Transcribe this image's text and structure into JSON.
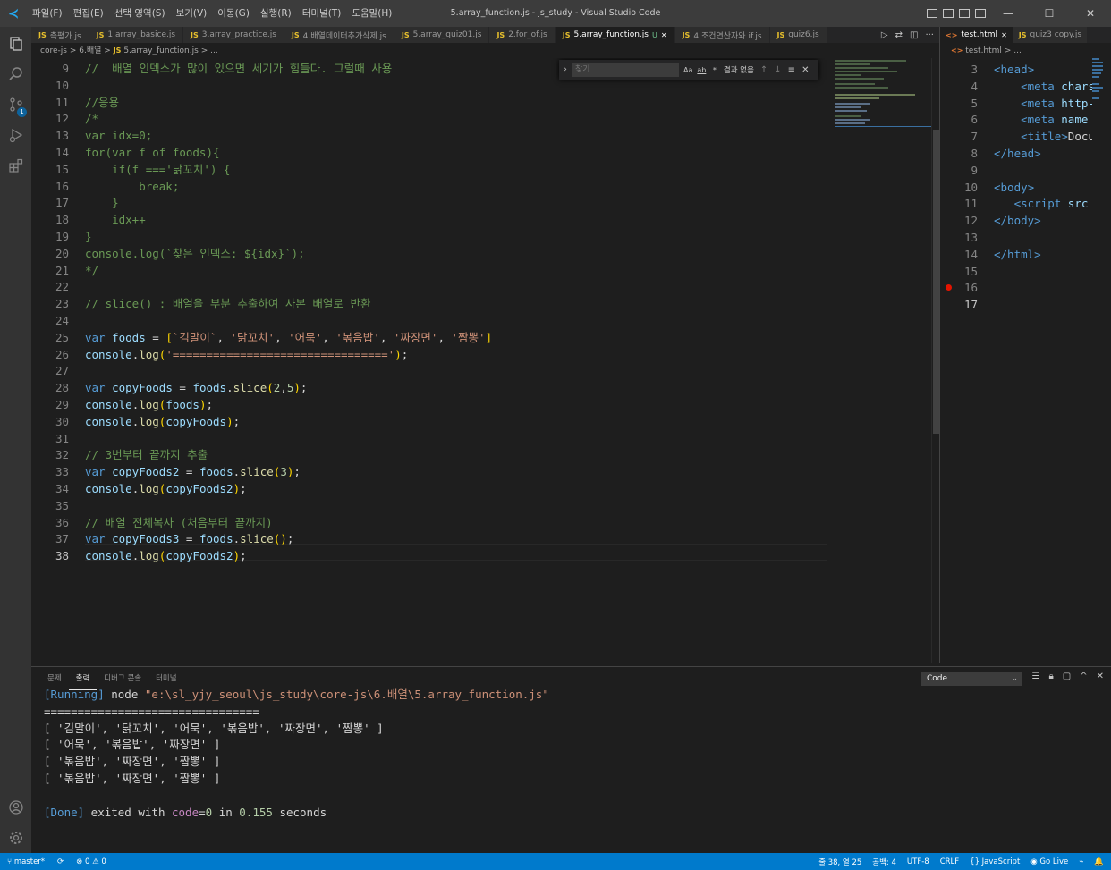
{
  "window": {
    "title": "5.array_function.js - js_study - Visual Studio Code",
    "menu": [
      "파일(F)",
      "편집(E)",
      "선택 영역(S)",
      "보기(V)",
      "이동(G)",
      "실행(R)",
      "터미널(T)",
      "도움말(H)"
    ],
    "controls": [
      "—",
      "☐",
      "✕"
    ]
  },
  "tabs": [
    {
      "label": "측평가.js",
      "type": "js",
      "active": false
    },
    {
      "label": "1.array_basice.js",
      "type": "js",
      "active": false
    },
    {
      "label": "3.array_practice.js",
      "type": "js",
      "active": false
    },
    {
      "label": "4.배열데이터추가삭제.js",
      "type": "js",
      "active": false
    },
    {
      "label": "5.array_quiz01.js",
      "type": "js",
      "active": false
    },
    {
      "label": "2.for_of.js",
      "type": "js",
      "active": false
    },
    {
      "label": "5.array_function.js",
      "type": "js",
      "active": true,
      "modified": "U",
      "close": "✕"
    },
    {
      "label": "4.조건연산자와 if.js",
      "type": "js",
      "active": false
    },
    {
      "label": "quiz6.js",
      "type": "js",
      "active": false
    }
  ],
  "tab_js_badge": "JS",
  "breadcrumb": {
    "parts": [
      "core-js",
      "6.배열",
      "5.array_function.js",
      "..."
    ],
    "sep": ">"
  },
  "find": {
    "placeholder": "찾기",
    "opt_case": "Aa",
    "opt_word": "ab",
    "opt_regex": ".*",
    "result": "결과 없음"
  },
  "editor_lines": [
    {
      "n": "9",
      "html": "<span class=\"c-cm\">//  배열 인덱스가 많이 있으면 세기가 힘들다. 그럴때 사용</span>"
    },
    {
      "n": "10",
      "html": ""
    },
    {
      "n": "11",
      "html": "<span class=\"c-cm\">//응용</span>"
    },
    {
      "n": "12",
      "html": "<span class=\"c-cm\">/*</span>"
    },
    {
      "n": "13",
      "html": "<span class=\"c-cm\">var idx=0;</span>"
    },
    {
      "n": "14",
      "html": "<span class=\"c-cm\">for(var f of foods){</span>"
    },
    {
      "n": "15",
      "html": "<span class=\"c-cm\">    if(f ==='닭꼬치') {</span>"
    },
    {
      "n": "16",
      "html": "<span class=\"c-cm\">        break;</span>"
    },
    {
      "n": "17",
      "html": "<span class=\"c-cm\">    }</span>"
    },
    {
      "n": "18",
      "html": "<span class=\"c-cm\">    idx++</span>"
    },
    {
      "n": "19",
      "html": "<span class=\"c-cm\">}</span>"
    },
    {
      "n": "20",
      "html": "<span class=\"c-cm\">console.log(`찾은 인덱스: ${idx}`);</span>"
    },
    {
      "n": "21",
      "html": "<span class=\"c-cm\">*/</span>"
    },
    {
      "n": "22",
      "html": ""
    },
    {
      "n": "23",
      "html": "<span class=\"c-cm\">// slice() : 배열을 부분 추출하여 사본 배열로 반환</span>"
    },
    {
      "n": "24",
      "html": ""
    },
    {
      "n": "25",
      "html": "<span class=\"c-kw\">var</span> <span class=\"c-vr\">foods</span> <span class=\"c-pl\">=</span> <span class=\"c-br\">[</span><span class=\"c-st\">`김말이`</span><span class=\"c-pl\">,</span> <span class=\"c-st\">'닭꼬치'</span><span class=\"c-pl\">,</span> <span class=\"c-st\">'어묵'</span><span class=\"c-pl\">,</span> <span class=\"c-st\">'볶음밥'</span><span class=\"c-pl\">,</span> <span class=\"c-st\">'짜장면'</span><span class=\"c-pl\">,</span> <span class=\"c-st\">'짬뽕'</span><span class=\"c-br\">]</span>"
    },
    {
      "n": "26",
      "html": "<span class=\"c-vr\">console</span><span class=\"c-pl\">.</span><span class=\"c-fn\">log</span><span class=\"c-br\">(</span><span class=\"c-st\">'================================'</span><span class=\"c-br\">)</span><span class=\"c-pl\">;</span>"
    },
    {
      "n": "27",
      "html": ""
    },
    {
      "n": "28",
      "html": "<span class=\"c-kw\">var</span> <span class=\"c-vr\">copyFoods</span> <span class=\"c-pl\">=</span> <span class=\"c-vr\">foods</span><span class=\"c-pl\">.</span><span class=\"c-fn\">slice</span><span class=\"c-br\">(</span><span class=\"c-nm\">2</span><span class=\"c-pl\">,</span><span class=\"c-nm\">5</span><span class=\"c-br\">)</span><span class=\"c-pl\">;</span>"
    },
    {
      "n": "29",
      "html": "<span class=\"c-vr\">console</span><span class=\"c-pl\">.</span><span class=\"c-fn\">log</span><span class=\"c-br\">(</span><span class=\"c-vr\">foods</span><span class=\"c-br\">)</span><span class=\"c-pl\">;</span>"
    },
    {
      "n": "30",
      "html": "<span class=\"c-vr\">console</span><span class=\"c-pl\">.</span><span class=\"c-fn\">log</span><span class=\"c-br\">(</span><span class=\"c-vr\">copyFoods</span><span class=\"c-br\">)</span><span class=\"c-pl\">;</span>"
    },
    {
      "n": "31",
      "html": ""
    },
    {
      "n": "32",
      "html": "<span class=\"c-cm\">// 3번부터 끝까지 추출</span>"
    },
    {
      "n": "33",
      "html": "<span class=\"c-kw\">var</span> <span class=\"c-vr\">copyFoods2</span> <span class=\"c-pl\">=</span> <span class=\"c-vr\">foods</span><span class=\"c-pl\">.</span><span class=\"c-fn\">slice</span><span class=\"c-br\">(</span><span class=\"c-nm\">3</span><span class=\"c-br\">)</span><span class=\"c-pl\">;</span>"
    },
    {
      "n": "34",
      "html": "<span class=\"c-vr\">console</span><span class=\"c-pl\">.</span><span class=\"c-fn\">log</span><span class=\"c-br\">(</span><span class=\"c-vr\">copyFoods2</span><span class=\"c-br\">)</span><span class=\"c-pl\">;</span>"
    },
    {
      "n": "35",
      "html": ""
    },
    {
      "n": "36",
      "html": "<span class=\"c-cm\">// 배열 전체복사 (처음부터 끝까지)</span>"
    },
    {
      "n": "37",
      "html": "<span class=\"c-kw\">var</span> <span class=\"c-vr\">copyFoods3</span> <span class=\"c-pl\">=</span> <span class=\"c-vr\">foods</span><span class=\"c-pl\">.</span><span class=\"c-fn\">slice</span><span class=\"c-br\">()</span><span class=\"c-pl\">;</span>"
    },
    {
      "n": "38",
      "html": "<span class=\"c-vr\">console</span><span class=\"c-pl\">.</span><span class=\"c-fn\">log</span><span class=\"c-br\">(</span><span class=\"c-vr\">copyFoods2</span><span class=\"c-br\">)</span><span class=\"c-pl\">;</span>",
      "current": true
    }
  ],
  "right_editor": {
    "tabs": [
      {
        "label": "test.html",
        "type": "html",
        "active": true,
        "close": "✕"
      },
      {
        "label": "quiz3 copy.js",
        "type": "js",
        "active": false
      }
    ],
    "tab_html_badge": "<>",
    "breadcrumb": [
      "test.html",
      "..."
    ],
    "lines": [
      {
        "n": "3",
        "html": "<span class=\"c-tag\">&lt;head&gt;</span>"
      },
      {
        "n": "4",
        "html": "    <span class=\"c-tag\">&lt;meta</span> <span class=\"c-at\">charset</span>"
      },
      {
        "n": "5",
        "html": "    <span class=\"c-tag\">&lt;meta</span> <span class=\"c-at\">http-equiv</span>"
      },
      {
        "n": "6",
        "html": "    <span class=\"c-tag\">&lt;meta</span> <span class=\"c-at\">name</span>"
      },
      {
        "n": "7",
        "html": "    <span class=\"c-tag\">&lt;title&gt;</span><span class=\"c-tx\">Document</span>"
      },
      {
        "n": "8",
        "html": "<span class=\"c-tag\">&lt;/head&gt;</span>"
      },
      {
        "n": "9",
        "html": ""
      },
      {
        "n": "10",
        "html": "<span class=\"c-tag\">&lt;body&gt;</span>"
      },
      {
        "n": "11",
        "html": "   <span class=\"c-tag\">&lt;script</span> <span class=\"c-at\">src</span>"
      },
      {
        "n": "12",
        "html": "<span class=\"c-tag\">&lt;/body&gt;</span>"
      },
      {
        "n": "13",
        "html": ""
      },
      {
        "n": "14",
        "html": "<span class=\"c-tag\">&lt;/html&gt;</span>"
      },
      {
        "n": "15",
        "html": ""
      },
      {
        "n": "16",
        "html": "",
        "breakpoint": true
      },
      {
        "n": "17",
        "html": "",
        "current": true
      }
    ]
  },
  "panel": {
    "tabs": [
      {
        "label": "문제",
        "active": false
      },
      {
        "label": "출력",
        "active": true
      },
      {
        "label": "디버그 콘솔",
        "active": false
      },
      {
        "label": "터미널",
        "active": false
      }
    ],
    "output_channel": "Code",
    "output_lines": [
      "<span class=\"o-blue\">[Running]</span> node <span class=\"c-st\">\"e:\\sl_yjy_seoul\\js_study\\core-js\\6.배열\\5.array_function.js\"</span>",
      "================================",
      "[ '김말이', '닭꼬치', '어묵', '볶음밥', '짜장면', '짬뽕' ]",
      "[ '어묵', '볶음밥', '짜장면' ]",
      "[ '볶음밥', '짜장면', '짬뽕' ]",
      "[ '볶음밥', '짜장면', '짬뽕' ]",
      "",
      "<span class=\"o-blue\">[Done]</span> exited with <span class=\"o-purple\">code</span>=<span class=\"o-num\">0</span> in <span class=\"o-num\">0.155</span> seconds"
    ]
  },
  "activity": {
    "scm_badge": "1"
  },
  "statusbar": {
    "branch": "master*",
    "sync": "⟳",
    "errors": "⊗ 0 ⚠ 0",
    "position": "줄 38, 열 25",
    "spaces": "공백: 4",
    "encoding": "UTF-8",
    "eol": "CRLF",
    "language": "{} JavaScript",
    "golive": "Go Live",
    "feedback": "⌁",
    "bell": "🔔"
  },
  "colors": {
    "accent": "#007acc",
    "titlebar": "#3c3c3c",
    "editor_bg": "#1e1e1e"
  }
}
